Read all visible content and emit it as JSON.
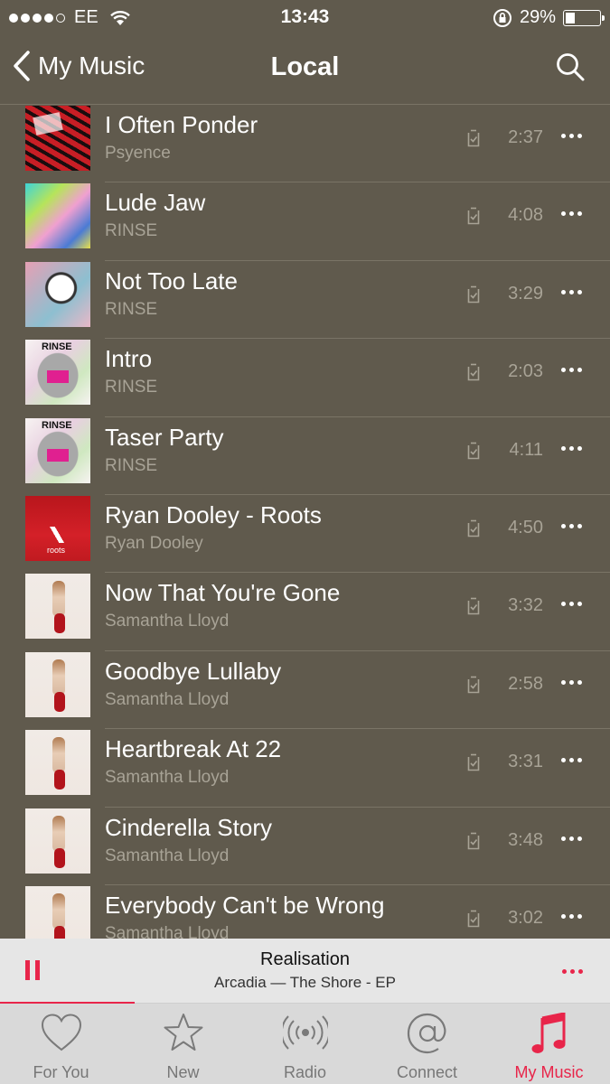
{
  "status_bar": {
    "carrier": "EE",
    "time": "13:43",
    "battery": "29%",
    "battery_level": 0.29
  },
  "nav": {
    "back_label": "My Music",
    "title": "Local"
  },
  "songs": [
    {
      "title": "I Often Ponder",
      "artist": "Psyence",
      "duration": "2:37",
      "art": "art-red"
    },
    {
      "title": "Lude Jaw",
      "artist": "RINSE",
      "duration": "4:08",
      "art": "art-rinse1"
    },
    {
      "title": "Not Too Late",
      "artist": "RINSE",
      "duration": "3:29",
      "art": "art-rinse2"
    },
    {
      "title": "Intro",
      "artist": "RINSE",
      "duration": "2:03",
      "art": "art-rinse3"
    },
    {
      "title": "Taser Party",
      "artist": "RINSE",
      "duration": "4:11",
      "art": "art-rinse3"
    },
    {
      "title": "Ryan Dooley - Roots",
      "artist": "Ryan Dooley",
      "duration": "4:50",
      "art": "art-adidas"
    },
    {
      "title": "Now That You're Gone",
      "artist": "Samantha Lloyd",
      "duration": "3:32",
      "art": "art-sam"
    },
    {
      "title": "Goodbye Lullaby",
      "artist": "Samantha Lloyd",
      "duration": "2:58",
      "art": "art-sam"
    },
    {
      "title": "Heartbreak At 22",
      "artist": "Samantha Lloyd",
      "duration": "3:31",
      "art": "art-sam"
    },
    {
      "title": "Cinderella Story",
      "artist": "Samantha Lloyd",
      "duration": "3:48",
      "art": "art-sam"
    },
    {
      "title": "Everybody Can't be Wrong",
      "artist": "Samantha Lloyd",
      "duration": "3:02",
      "art": "art-sam"
    }
  ],
  "now_playing": {
    "title": "Realisation",
    "subtitle": "Arcadia — The Shore - EP",
    "progress": 0.22
  },
  "tabs": [
    {
      "label": "For You",
      "icon": "heart-icon",
      "active": false
    },
    {
      "label": "New",
      "icon": "star-icon",
      "active": false
    },
    {
      "label": "Radio",
      "icon": "radio-icon",
      "active": false
    },
    {
      "label": "Connect",
      "icon": "at-icon",
      "active": false
    },
    {
      "label": "My Music",
      "icon": "music-note-icon",
      "active": true
    }
  ],
  "colors": {
    "background": "#605a4d",
    "accent": "#e8254a",
    "secondary_text": "#a8a396"
  }
}
